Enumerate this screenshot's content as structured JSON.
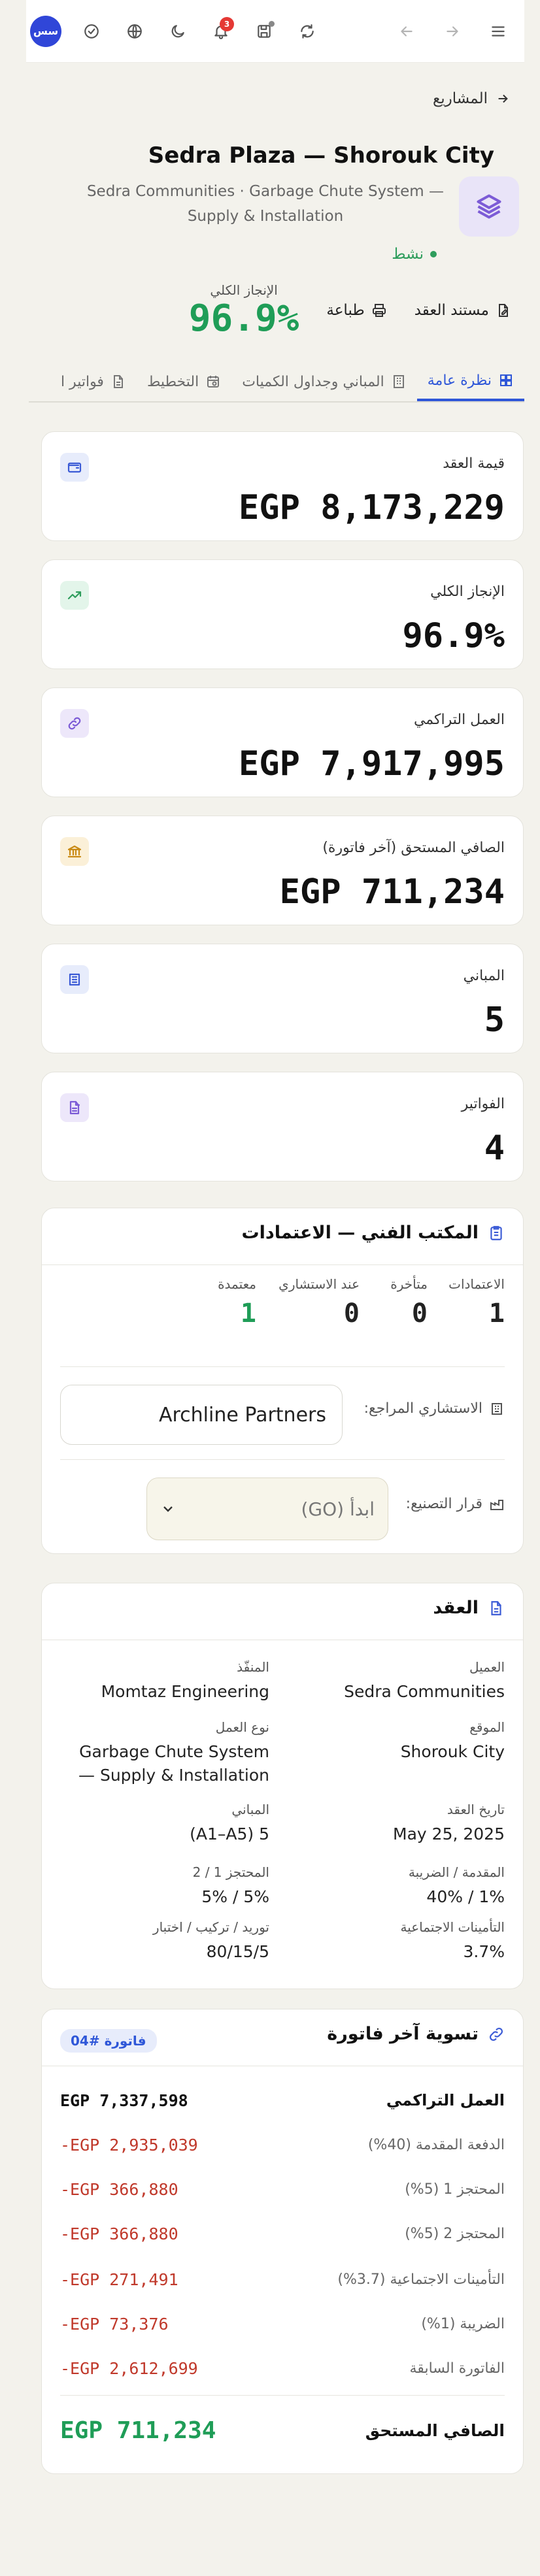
{
  "topbar": {
    "avatar_initials": "سس",
    "notifications_count": "3",
    "icons": [
      "menu-icon",
      "forward-arrow-icon",
      "back-arrow-icon",
      "refresh-icon",
      "save-icon",
      "bell-icon",
      "moon-icon",
      "globe-icon",
      "check-circle-icon"
    ]
  },
  "header": {
    "back_label": "المشاريع",
    "title": "Sedra Plaza — Shorouk City",
    "subtitle": "Sedra Communities · Garbage Chute System — Supply & Installation",
    "status": "نشط",
    "status_color": "#2e9d5c",
    "actions": {
      "contract_doc": "مستند العقد",
      "print": "طباعة"
    },
    "overall_label": "الإنجاز الكلي",
    "overall_value": "96.9%"
  },
  "tabs": [
    {
      "label": "نظرة عامة",
      "active": true
    },
    {
      "label": "المباني وجداول الكميات",
      "active": false
    },
    {
      "label": "التخطيط",
      "active": false
    },
    {
      "label": "فواتير ا",
      "active": false
    }
  ],
  "stats": [
    {
      "label": "قيمة العقد",
      "value": "EGP 8,173,229",
      "icon": "wallet-icon",
      "color": "#3b5bd6",
      "bg": "#e7ecfb"
    },
    {
      "label": "الإنجاز الكلي",
      "value": "96.9%",
      "icon": "trending-up-icon",
      "color": "#2e9d5c",
      "bg": "#e3f5ea"
    },
    {
      "label": "العمل التراكمي",
      "value": "EGP 7,917,995",
      "icon": "link-icon",
      "color": "#7c5bd6",
      "bg": "#ede7fa"
    },
    {
      "label": "الصافي المستحق (آخر فاتورة)",
      "value": "EGP 711,234",
      "icon": "bank-icon",
      "color": "#c98a14",
      "bg": "#fbf0d8"
    },
    {
      "label": "المباني",
      "value": "5",
      "icon": "building-icon",
      "color": "#3b5bd6",
      "bg": "#e7ecfb"
    },
    {
      "label": "الفواتير",
      "value": "4",
      "icon": "invoice-icon",
      "color": "#7c5bd6",
      "bg": "#ede7fa"
    }
  ],
  "tech_office": {
    "title": "المكتب الفني — الاعتمادات",
    "approvals": [
      {
        "label": "الاعتمادات",
        "value": "1"
      },
      {
        "label": "متأخرة",
        "value": "0"
      },
      {
        "label": "عند الاستشاري",
        "value": "0"
      },
      {
        "label": "معتمدة",
        "value": "1"
      }
    ],
    "consultant_label": "الاستشاري المراجع:",
    "consultant_value": "Archline Partners",
    "manufacturing_label": "قرار التصنيع:",
    "manufacturing_value": "ابدأ (GO)"
  },
  "contract": {
    "title": "العقد",
    "fields": [
      {
        "k": "العميل",
        "v": "Sedra Communities"
      },
      {
        "k": "المنفّذ",
        "v": "Momtaz Engineering"
      },
      {
        "k": "الموقع",
        "v": "Shorouk City"
      },
      {
        "k": "نوع العمل",
        "v": "Garbage Chute System — Supply & Installation"
      },
      {
        "k": "تاريخ العقد",
        "v": "May 25, 2025"
      },
      {
        "k": "المباني",
        "v": "5 (A1–A5)"
      },
      {
        "k": "المقدمة / الضريبة",
        "v": "1% / 40%"
      },
      {
        "k": "المحتجز 1 / 2",
        "v": "5% / 5%"
      },
      {
        "k": "التأمينات الاجتماعية",
        "v": "3.7%"
      },
      {
        "k": "توريد / تركيب / اختبار",
        "v": "80/15/5"
      }
    ]
  },
  "invoice": {
    "title": "تسوية آخر فاتورة",
    "badge": "فاتورة #04",
    "rows": [
      {
        "label": "العمل التراكمي",
        "value": "EGP 7,337,598"
      },
      {
        "label": "الدفعة المقدمة (40%)",
        "value": "-EGP 2,935,039"
      },
      {
        "label": "المحتجز 1 (5%)",
        "value": "-EGP 366,880"
      },
      {
        "label": "المحتجز 2 (5%)",
        "value": "-EGP 366,880"
      },
      {
        "label": "التأمينات الاجتماعية (3.7%)",
        "value": "-EGP 271,491"
      },
      {
        "label": "الضريبة (1%)",
        "value": "-EGP 73,376"
      },
      {
        "label": "الفاتورة السابقة",
        "value": "-EGP 2,612,699"
      }
    ],
    "net_label": "الصافي المستحق",
    "net_value": "EGP 711,234"
  }
}
